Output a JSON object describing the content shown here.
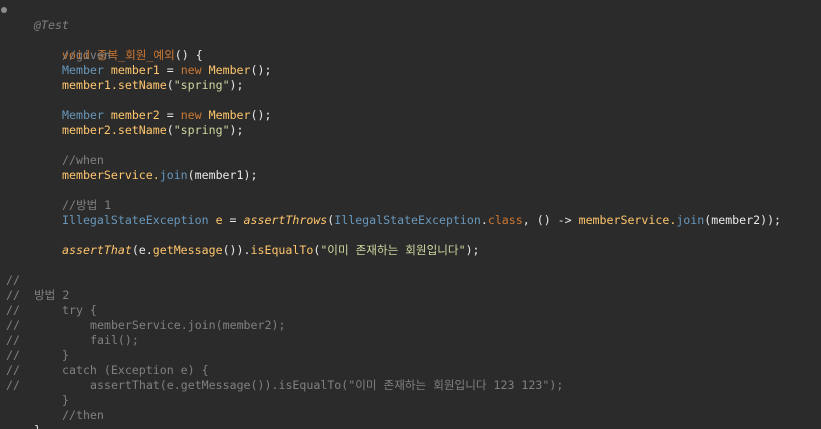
{
  "editor": {
    "lines": {
      "l1": {
        "annotation": "@Test"
      },
      "l2": {
        "kw": "void",
        "name": "중복_회원_예외",
        "rest": "() {"
      },
      "l3": {
        "comment": "//given"
      },
      "l4": {
        "type": "Member",
        "var": "member1",
        "eq": " = ",
        "kw": "new",
        "cls": " Member",
        "end": "();"
      },
      "l5": {
        "obj": "member1.",
        "method": "setName",
        "open": "(",
        "str": "\"spring\"",
        "end": ");"
      },
      "l6": {
        "type": "Member",
        "var": "member2",
        "eq": " = ",
        "kw": "new",
        "cls": " Member",
        "end": "();"
      },
      "l7": {
        "obj": "member2.",
        "method": "setName",
        "open": "(",
        "str": "\"spring\"",
        "end": ");"
      },
      "l8": {
        "comment": "//when"
      },
      "l9": {
        "obj": "memberService.",
        "method": "join",
        "end": "(member1);"
      },
      "l10": {
        "comment": "//방법 1"
      },
      "l11": {
        "type": "IllegalStateException",
        "var": " e",
        "eq": " = ",
        "fn": "assertThrows",
        "open": "(",
        "cls": "IllegalStateException",
        "dot": ".",
        "kw": "class",
        "mid": ", () -> ",
        "obj": "memberService.",
        "method": "join",
        "end": "(member2));"
      },
      "l12": {
        "fn": "assertThat",
        "open": "(e.",
        "method": "getMessage",
        "mid": "()).",
        "method2": "isEqualTo",
        "open2": "(",
        "str": "\"이미 존재하는 회원입니다\"",
        "end": ");"
      },
      "l13": {
        "prefix": "//",
        "comment": "방법 2"
      },
      "l14": {
        "prefix": "//",
        "code": "try {"
      },
      "l15": {
        "prefix": "//",
        "code": "memberService.join(member2);"
      },
      "l16": {
        "prefix": "//",
        "code": "fail();"
      },
      "l17": {
        "prefix": "//",
        "code": "}"
      },
      "l18": {
        "prefix": "//",
        "code": "catch (Exception e) {"
      },
      "l19": {
        "prefix": "//",
        "code": "assertThat(e.getMessage()).isEqualTo(\"이미 존재하는 회원입니다 123 123\");"
      },
      "l20": {
        "prefix": "//",
        "code": "}"
      },
      "l21": {
        "comment": "//then"
      },
      "l22": {
        "code": "}"
      }
    }
  }
}
